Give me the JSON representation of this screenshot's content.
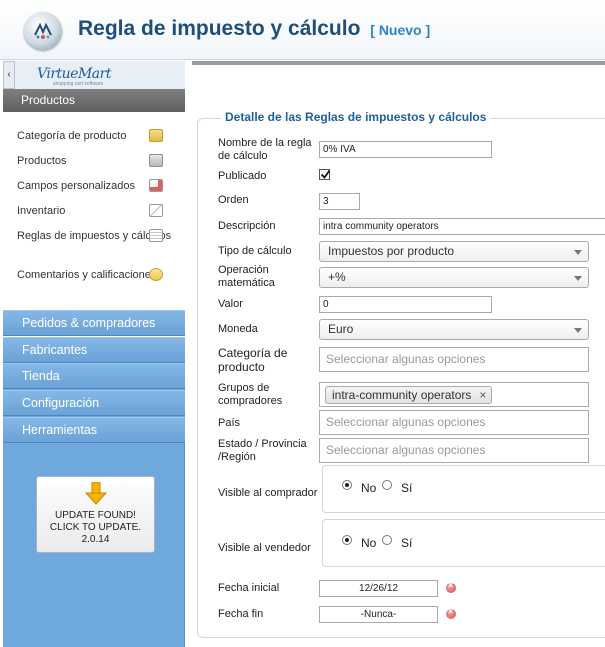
{
  "header": {
    "title": "Regla de impuesto y cálculo",
    "tag": "[ Nuevo ]",
    "logo_icon": "virtuemart-logo-icon"
  },
  "sidebar": {
    "collapse_glyph": "‹",
    "brand": "VirtueMart",
    "brand_sub": "shopping cart software",
    "active_section": "Productos",
    "sub_items": [
      {
        "label": "Categoría de producto",
        "icon": "folder-icon"
      },
      {
        "label": "Productos",
        "icon": "box-icon"
      },
      {
        "label": "Campos personalizados",
        "icon": "custom-fields-icon"
      },
      {
        "label": "Inventario",
        "icon": "chart-icon"
      },
      {
        "label": "Reglas de impuestos y cálculos",
        "icon": "calculator-icon"
      },
      {
        "label": "Comentarios y calificaciones",
        "icon": "speech-bubble-icon"
      }
    ],
    "menu": [
      "Pedidos & compradores",
      "Fabricantes",
      "Tienda",
      "Configuración",
      "Herramientas"
    ],
    "update": {
      "line1": "UPDATE FOUND!",
      "line2": "CLICK TO UPDATE.",
      "version": "2.0.14"
    }
  },
  "form": {
    "legend": "Detalle de las Reglas de impuestos y cálculos",
    "name": {
      "label": "Nombre de la regla de cálculo",
      "value": "0% IVA"
    },
    "published": {
      "label": "Publicado",
      "checked": true
    },
    "order": {
      "label": "Orden",
      "value": "3"
    },
    "description": {
      "label": "Descripción",
      "value": "intra community operators"
    },
    "calc_type": {
      "label": "Tipo de cálculo",
      "value": "Impuestos por producto"
    },
    "math_op": {
      "label": "Operación matemática",
      "value": "+%"
    },
    "value": {
      "label": "Valor",
      "value": "0"
    },
    "currency": {
      "label": "Moneda",
      "value": "Euro"
    },
    "product_category": {
      "label": "Categoría de producto",
      "placeholder": "Seleccionar algunas opciones"
    },
    "shopper_groups": {
      "label": "Grupos de compradores",
      "chip": "intra-community operators",
      "chip_close": "×"
    },
    "country": {
      "label": "País",
      "placeholder": "Seleccionar algunas opciones"
    },
    "state": {
      "label": "Estado / Provincia /Región",
      "placeholder": "Seleccionar algunas opciones"
    },
    "visible_shopper": {
      "label": "Visible al comprador",
      "no": "No",
      "yes": "Sí",
      "selected": "No"
    },
    "visible_vendor": {
      "label": "Visible al vendedor",
      "no": "No",
      "yes": "Sí",
      "selected": "No"
    },
    "start_date": {
      "label": "Fecha inicial",
      "value": "12/26/12"
    },
    "end_date": {
      "label": "Fecha fin",
      "value": "-Nunca-"
    }
  }
}
